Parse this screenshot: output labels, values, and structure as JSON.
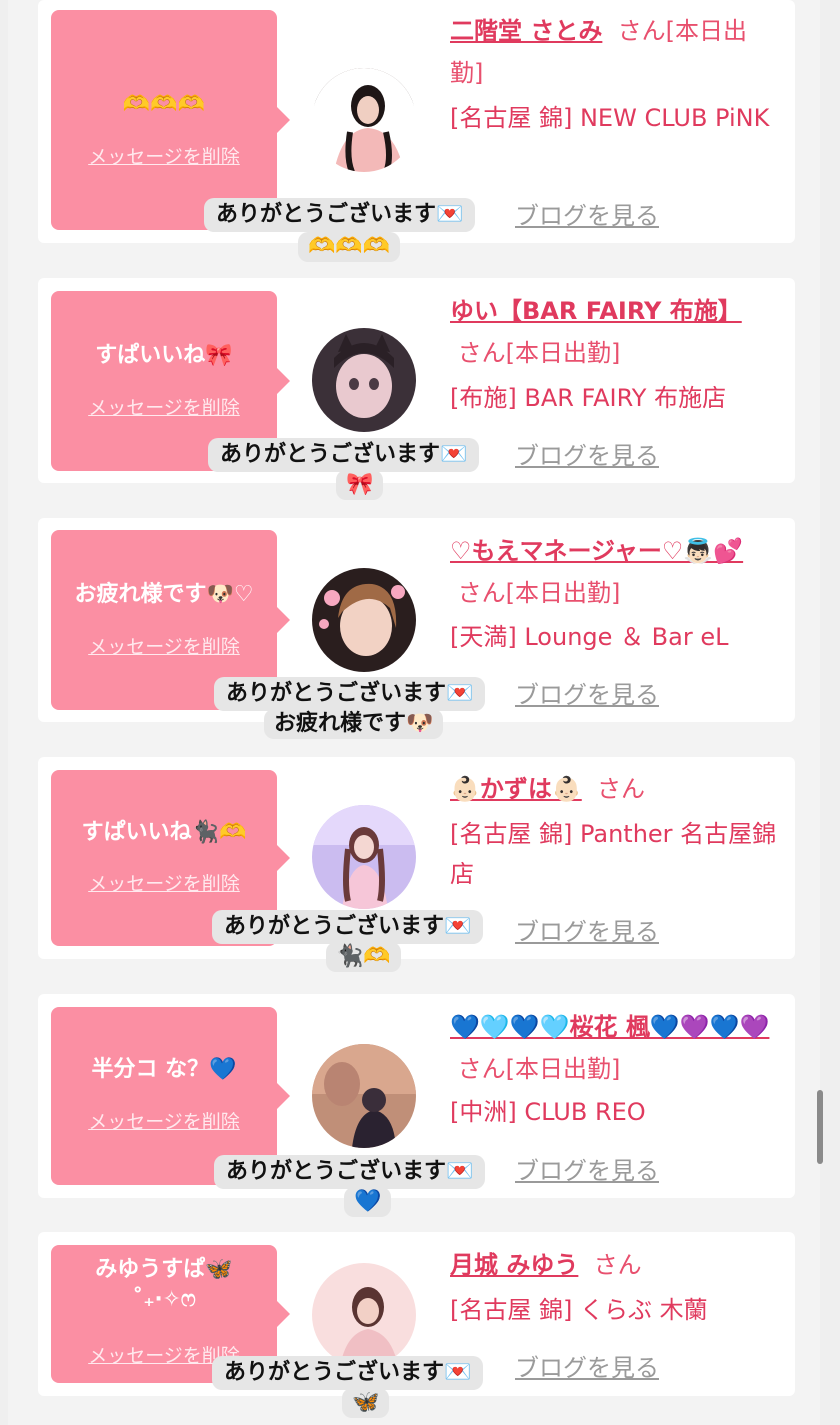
{
  "delete_label": "メッセージを削除",
  "blog_label": "ブログを見る",
  "reply_prefix": "ありがとうございます💌",
  "items": [
    {
      "bubble": "🫶🫶🫶",
      "name": "二階堂 さとみ",
      "san": "さん[本日出勤]",
      "shop": "[名古屋 錦] NEW CLUB PiNK",
      "reply_line2": "🫶🫶🫶"
    },
    {
      "bubble": "すぱいいね🎀",
      "name": "ゆい【BAR FAIRY 布施】",
      "san": "さん[本日出勤]",
      "shop": "[布施] BAR FAIRY 布施店",
      "reply_line2": "🎀"
    },
    {
      "bubble": "お疲れ様です🐶♡",
      "name": "♡もえマネージャー♡👼🏻💕",
      "san": "さん[本日出勤]",
      "shop": "[天満] Lounge ＆ Bar eL",
      "reply_line2": "お疲れ様です🐶"
    },
    {
      "bubble": "すぱいいね🐈‍⬛🫶",
      "name": "👶🏻かずは👶🏻",
      "san": "さん",
      "shop": "[名古屋 錦] Panther 名古屋錦店",
      "reply_line2": "🐈‍⬛🫶"
    },
    {
      "bubble": "半分コ な？💙",
      "name": "💙🩵💙🩵桜花 楓💙💜💙💜",
      "san": "さん[本日出勤]",
      "shop": "[中洲] CLUB REO",
      "reply_line2": "💙"
    },
    {
      "bubble": "みゆうすぱ🦋\n˚₊‧✧ෆ",
      "name": "月城 みゆう",
      "san": "さん",
      "shop": "[名古屋 錦] くらぶ 木蘭",
      "reply_line2": "🦋"
    }
  ]
}
